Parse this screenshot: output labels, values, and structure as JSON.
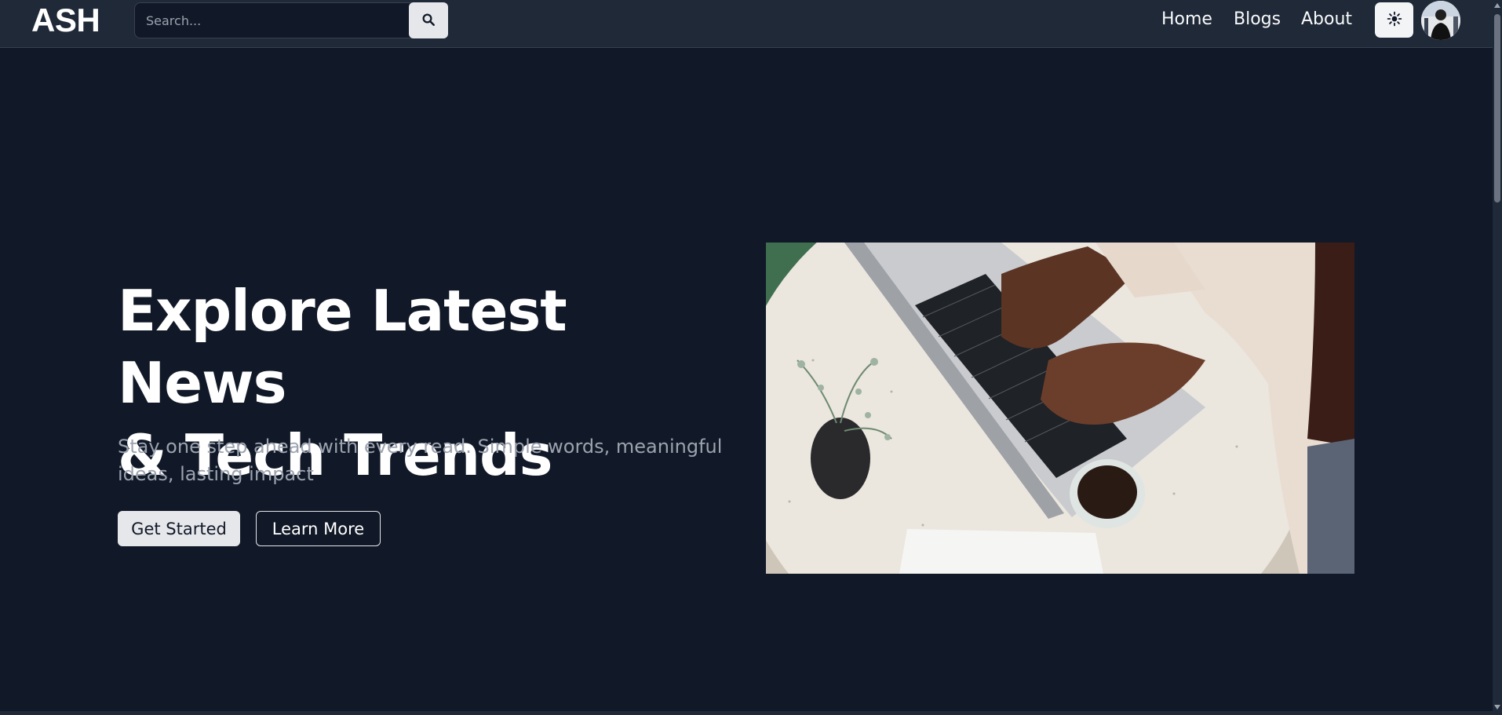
{
  "header": {
    "logo": "ASH",
    "search": {
      "placeholder": "Search...",
      "value": ""
    },
    "nav": [
      {
        "label": "Home"
      },
      {
        "label": "Blogs"
      },
      {
        "label": "About"
      }
    ]
  },
  "hero": {
    "title_line1": "Explore Latest News",
    "title_line2": "& Tech Trends",
    "subtitle": "Stay one step ahead with every read. Simple words, meaningful ideas, lasting impact",
    "primary_button": "Get Started",
    "secondary_button": "Learn More"
  },
  "icons": {
    "search": "search-icon",
    "theme": "sun-icon",
    "avatar": "user-avatar"
  },
  "colors": {
    "background": "#111827",
    "header": "#1f2937",
    "text": "#ffffff",
    "muted": "#9ca3af",
    "button_light": "#e5e7eb"
  }
}
